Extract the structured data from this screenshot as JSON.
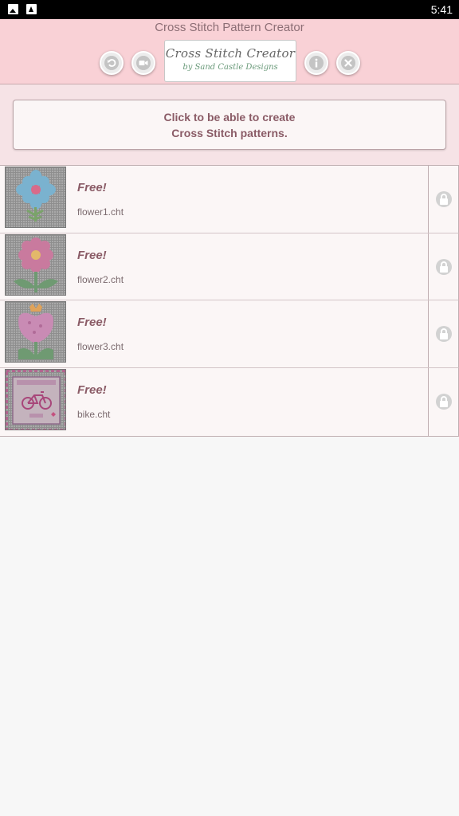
{
  "status_bar": {
    "time": "5:41"
  },
  "header": {
    "title": "Cross Stitch Pattern Creator",
    "logo_line1": "Cross Stitch Creator",
    "logo_line2": "by Sand Castle Designs",
    "buttons": [
      "undo-icon",
      "video-icon",
      "info-icon",
      "close-icon"
    ]
  },
  "banner": {
    "line1": "Click to be able to create",
    "line2": "Cross Stitch patterns."
  },
  "patterns": [
    {
      "price": "Free!",
      "file": "flower1.cht",
      "icon": "flower1-thumbnail"
    },
    {
      "price": "Free!",
      "file": "flower2.cht",
      "icon": "flower2-thumbnail"
    },
    {
      "price": "Free!",
      "file": "flower3.cht",
      "icon": "flower3-thumbnail"
    },
    {
      "price": "Free!",
      "file": "bike.cht",
      "icon": "bike-thumbnail"
    }
  ],
  "colors": {
    "header_bg": "#f9d1d6",
    "accent_text": "#8a5b66",
    "row_bg": "#fbf6f6"
  }
}
